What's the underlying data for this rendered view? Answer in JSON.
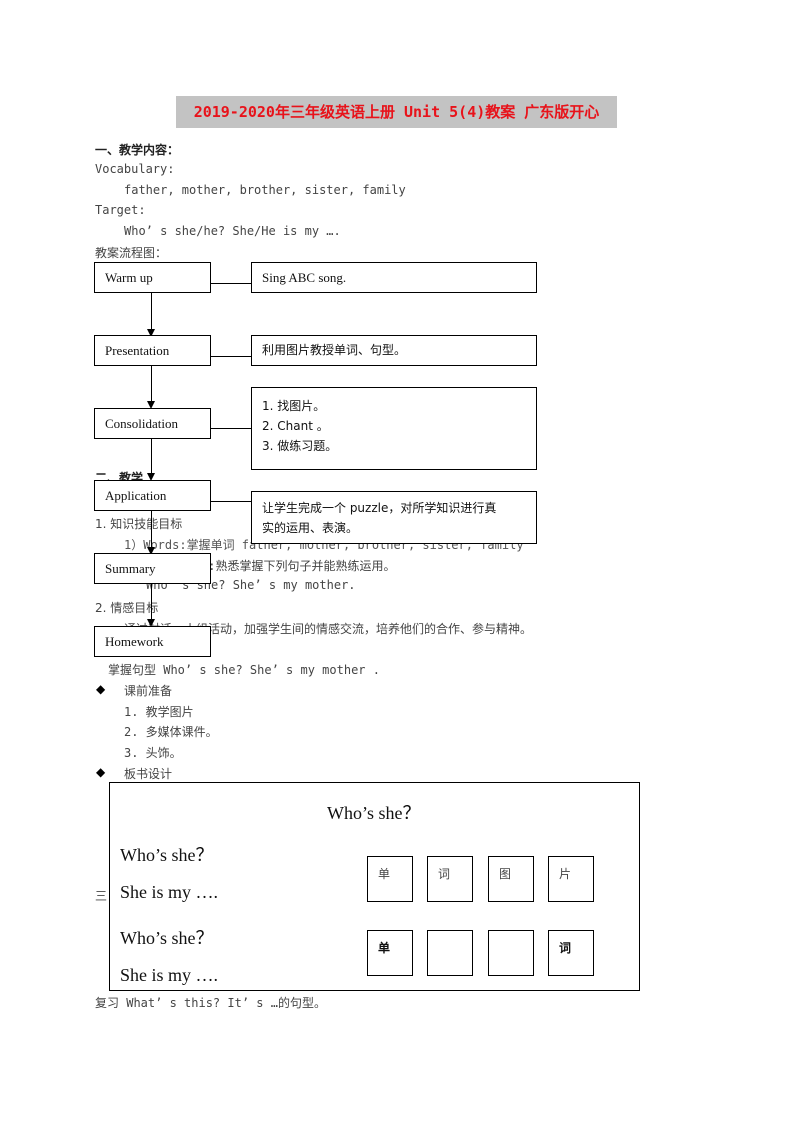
{
  "title": "2019-2020年三年级英语上册 Unit 5(4)教案 广东版开心",
  "colors": {
    "title_text": "#e8121a",
    "title_bg": "#c3c3c3"
  },
  "section1": {
    "heading": "一、教学内容：",
    "vocab_label": "Vocabulary:",
    "vocab_words": "father, mother, brother, sister, family",
    "target_label": "Target:",
    "target_sentence": "Who’ s she/he?  She/He is my ….",
    "flow_label": "教案流程图："
  },
  "flowchart": {
    "stages": [
      {
        "label": "Warm up",
        "desc": "Sing ABC song."
      },
      {
        "label": "Presentation",
        "desc": "利用图片教授单词、句型。"
      },
      {
        "label": "Consolidation",
        "desc_items": [
          "1.   找图片。",
          "2.   Chant  。",
          "3.   做练习题。"
        ]
      },
      {
        "label": "Application",
        "desc_lines": [
          "让学生完成一个 puzzle，对所学知识进行真",
          "实的运用、表演。"
        ]
      },
      {
        "label": "Summary"
      },
      {
        "label": "Homework"
      }
    ]
  },
  "section2": {
    "heading_partial": "二、教学",
    "item1": "1.  知识技能目标",
    "item1_1": "1）Words:掌握单词 father, mother, brother, sister, family",
    "item1_2": "2）Sentences:熟悉掌握下列句子并能熟练运用。",
    "item1_2_example": "Who’ s she?    She’ s my mother.",
    "item2": "2.  情感目标",
    "item2_text": "通过对话、小组活动，加强学生间的情感交流，培养他们的合作、参与精神。",
    "key_point": "掌握句型 Who’ s she?   She’ s my mother ."
  },
  "prep": {
    "bullet": "◆",
    "heading": "课前准备",
    "items": [
      "1.  教学图片",
      "2.  多媒体课件。",
      "3.  头饰。"
    ]
  },
  "board_design": {
    "bullet": "◆",
    "heading": "板书设计",
    "title": "Who’s she？",
    "lines": [
      "Who’s she？",
      "She is my  ….",
      "Who’s she？",
      "She is my  …."
    ],
    "cards_row1": [
      "单",
      "词",
      "图",
      "片"
    ],
    "cards_row2": [
      "单",
      "",
      "",
      "词"
    ]
  },
  "section3": {
    "heading_partial": "三",
    "paren1": "（",
    "paren2": "（",
    "review": "复习 What’ s this?   It’ s …的句型。"
  }
}
